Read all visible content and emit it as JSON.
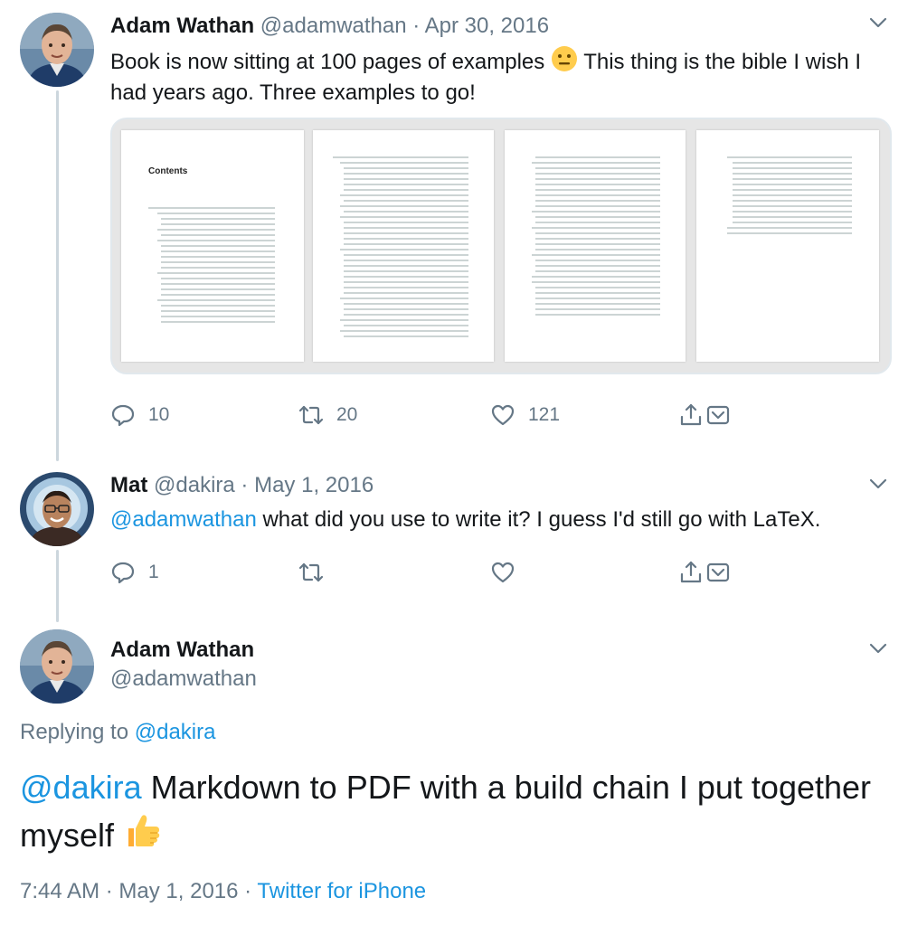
{
  "tweets": [
    {
      "author_name": "Adam Wathan",
      "handle": "@adamwathan",
      "separator": "·",
      "date": "Apr 30, 2016",
      "text_part1": "Book is now sitting at 100 pages of examples ",
      "text_part2": " This thing is the bible I wish I had years ago. Three examples to go!",
      "media_alt": "Book table of contents pages",
      "media_page1_title": "Contents",
      "replies": "10",
      "retweets": "20",
      "likes": "121"
    },
    {
      "author_name": "Mat",
      "handle": "@dakira",
      "separator": "·",
      "date": "May 1, 2016",
      "mention": "@adamwathan",
      "text": " what did you use to write it? I guess I'd still go with LaTeX.",
      "replies": "1",
      "retweets": "",
      "likes": ""
    }
  ],
  "focused_tweet": {
    "author_name": "Adam Wathan",
    "handle": "@adamwathan",
    "replying_label": "Replying to ",
    "replying_handle": "@dakira",
    "mention": "@dakira",
    "text": " Markdown to PDF with a build chain I put together myself ",
    "time": "7:44 AM",
    "separator": "·",
    "date": "May 1, 2016",
    "separator2": "·",
    "source": "Twitter for iPhone"
  },
  "colors": {
    "link_blue": "#1b95e0",
    "muted_gray": "#657786",
    "text_dark": "#14171a",
    "thread_line": "#ccd6dd"
  },
  "icons": [
    "chevron-down-icon",
    "reply-icon",
    "retweet-icon",
    "like-icon",
    "share-icon",
    "message-icon",
    "neutral-face-emoji",
    "thumbs-up-emoji"
  ]
}
